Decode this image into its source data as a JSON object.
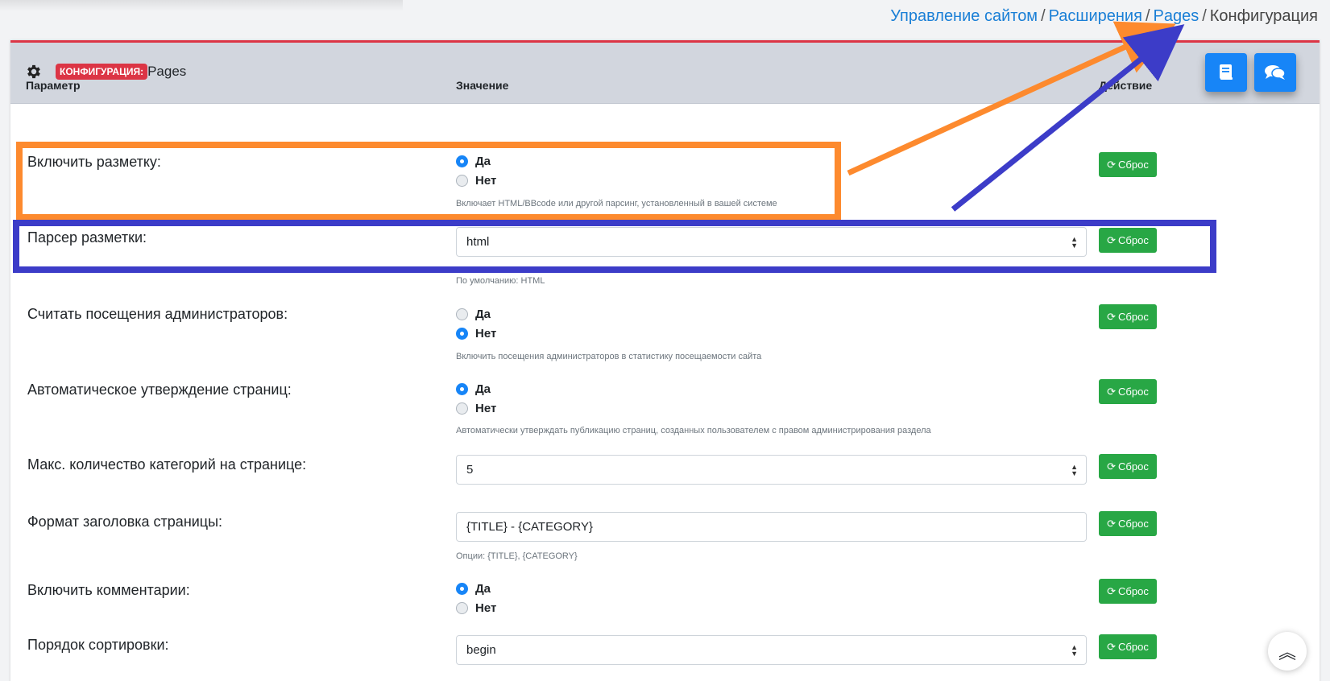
{
  "breadcrumb": {
    "items": [
      "Управление сайтом",
      "Расширения",
      "Pages"
    ],
    "current": "Конфигурация",
    "separator": "/"
  },
  "header": {
    "badge": "КОНФИГУРАЦИЯ:",
    "title": "Pages",
    "icons": [
      "gear-icon",
      "book-icon",
      "comments-icon"
    ]
  },
  "table": {
    "col_param": "Параметр",
    "col_value": "Значение",
    "col_action": "Действие"
  },
  "reset_label": "Сброс",
  "radio": {
    "yes": "Да",
    "no": "Нет"
  },
  "rows": [
    {
      "label": "Включить разметку:",
      "type": "radio",
      "selected": "yes",
      "help": "Включает HTML/BBcode или другой парсинг, установленный в вашей системе"
    },
    {
      "label": "Парсер разметки:",
      "type": "select",
      "value": "html",
      "help": "По умолчанию: HTML"
    },
    {
      "label": "Считать посещения администраторов:",
      "type": "radio",
      "selected": "no",
      "help": "Включить посещения администраторов в статистику посещаемости сайта"
    },
    {
      "label": "Автоматическое утверждение страниц:",
      "type": "radio",
      "selected": "yes",
      "help": "Автоматически утверждать публикацию страниц, созданных пользователем с правом администрирования раздела"
    },
    {
      "label": "Макс. количество категорий на странице:",
      "type": "select",
      "value": "5"
    },
    {
      "label": "Формат заголовка страницы:",
      "type": "text",
      "value": "{TITLE} - {CATEGORY}",
      "help": "Опции: {TITLE}, {CATEGORY}"
    },
    {
      "label": "Включить комментарии:",
      "type": "radio",
      "selected": "yes"
    },
    {
      "label": "Порядок сортировки:",
      "type": "select",
      "value": "begin"
    }
  ],
  "colors": {
    "accent": "#1785f7",
    "reset": "#28a745",
    "badge": "#dc3545",
    "annotation_orange": "#fd8a2e",
    "annotation_blue": "#3c3cc8"
  }
}
